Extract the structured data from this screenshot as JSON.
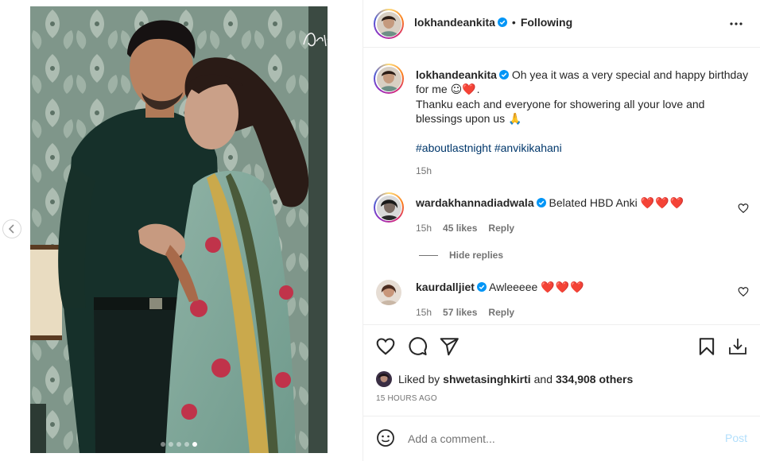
{
  "post": {
    "author": "lokhandeankita",
    "follow_sep": "•",
    "follow_status": "Following"
  },
  "caption": {
    "username": "lokhandeankita",
    "text_line1": "Oh yea it was a very special and happy birthday",
    "text_line2_pre": "for me ",
    "text_line2_emoji": "☺",
    "text_line2_heart": "❤️",
    "text_line2_end": ".",
    "text_line3": "Thanku each and everyone for showering all your love and",
    "text_line4_pre": "blessings upon us ",
    "text_line4_emoji": "🙏",
    "hashtags": "#aboutlastnight #anvikikahani",
    "time": "15h"
  },
  "comments": [
    {
      "username": "wardakhannadiadwala",
      "text": "Belated HBD Anki",
      "hearts": "❤️❤️❤️",
      "time": "15h",
      "likes": "45 likes",
      "reply": "Reply"
    },
    {
      "username": "kaurdalljiet",
      "text": "Awleeeee",
      "hearts": "❤️❤️❤️",
      "time": "15h",
      "likes": "57 likes",
      "reply": "Reply"
    }
  ],
  "hide_replies": "Hide replies",
  "likes": {
    "prefix": "Liked by",
    "user": "shwetasinghkirti",
    "and": "and",
    "others": "334,908 others"
  },
  "timestamp": "15 HOURS AGO",
  "add_comment": {
    "placeholder": "Add a comment...",
    "post_label": "Post"
  },
  "carousel": {
    "slides": 5,
    "active_index": 4
  },
  "colors": {
    "verified": "#0095f6",
    "link": "#00376b",
    "muted": "#737373",
    "post_disabled": "#b2dffc"
  },
  "icons": [
    "heart-icon",
    "comment-icon",
    "share-icon",
    "bookmark-icon",
    "download-icon",
    "emoji-icon",
    "more-icon",
    "chevron-left-icon",
    "verified-icon"
  ]
}
